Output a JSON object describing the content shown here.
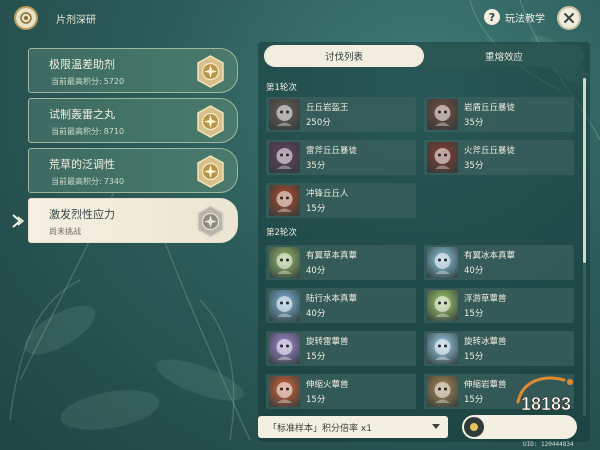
{
  "header": {
    "title": "片剂深研",
    "help_label": "玩法教学",
    "icons": {
      "event": "event-emblem-icon",
      "help": "question-icon",
      "close": "close-icon"
    }
  },
  "sidebar": {
    "items": [
      {
        "title": "极限温差助剂",
        "score_label": "当前最高积分:",
        "score": "5720",
        "medal": "gold",
        "selected": false
      },
      {
        "title": "试制轰雷之丸",
        "score_label": "当前最高积分:",
        "score": "8710",
        "medal": "gold",
        "selected": false
      },
      {
        "title": "荒草的泛调性",
        "score_label": "当前最高积分:",
        "score": "7340",
        "medal": "gold",
        "selected": false
      },
      {
        "title": "激发烈性应力",
        "score_label": "尚未挑战",
        "score": "",
        "medal": "grey",
        "selected": true
      }
    ]
  },
  "tabs": [
    {
      "label": "讨伐列表",
      "active": true
    },
    {
      "label": "重熔效应",
      "active": false
    }
  ],
  "rounds": [
    {
      "label": "第1轮次",
      "enemies": [
        {
          "name": "丘丘岩盔王",
          "points": "250分",
          "icon": "hilichurl-king-icon",
          "color": "#6b5a52"
        },
        {
          "name": "岩盾丘丘暴徒",
          "points": "35分",
          "icon": "mitachurl-icon",
          "color": "#7a4a3e"
        },
        {
          "name": "雷斧丘丘暴徒",
          "points": "35分",
          "icon": "mitachurl-icon",
          "color": "#6a4060"
        },
        {
          "name": "火斧丘丘暴徒",
          "points": "35分",
          "icon": "mitachurl-icon",
          "color": "#8a3a2e"
        },
        {
          "name": "冲锋丘丘人",
          "points": "15分",
          "icon": "hilichurl-icon",
          "color": "#b04a2a"
        }
      ]
    },
    {
      "label": "第2轮次",
      "enemies": [
        {
          "name": "有翼草本真蕈",
          "points": "40分",
          "icon": "fungus-icon",
          "color": "#9bbf6a"
        },
        {
          "name": "有翼冰本真蕈",
          "points": "40分",
          "icon": "fungus-icon",
          "color": "#8ec6e0"
        },
        {
          "name": "陆行水本真蕈",
          "points": "40分",
          "icon": "fungus-icon",
          "color": "#7fb8dc"
        },
        {
          "name": "浮游草蕈兽",
          "points": "15分",
          "icon": "fungus-icon",
          "color": "#a6cf6e"
        },
        {
          "name": "旋转雷蕈兽",
          "points": "15分",
          "icon": "fungus-icon",
          "color": "#a88bd8"
        },
        {
          "name": "旋转冰蕈兽",
          "points": "15分",
          "icon": "fungus-icon",
          "color": "#9fd0ea"
        },
        {
          "name": "伸缩火蕈兽",
          "points": "15分",
          "icon": "fungus-icon",
          "color": "#d9643a"
        },
        {
          "name": "伸缩岩蕈兽",
          "points": "15分",
          "icon": "fungus-icon",
          "color": "#b08a52"
        }
      ]
    }
  ],
  "footer": {
    "multiplier": "「标准样本」积分倍率 x1",
    "uid": "UID: 120444834",
    "watermark": "18183"
  }
}
